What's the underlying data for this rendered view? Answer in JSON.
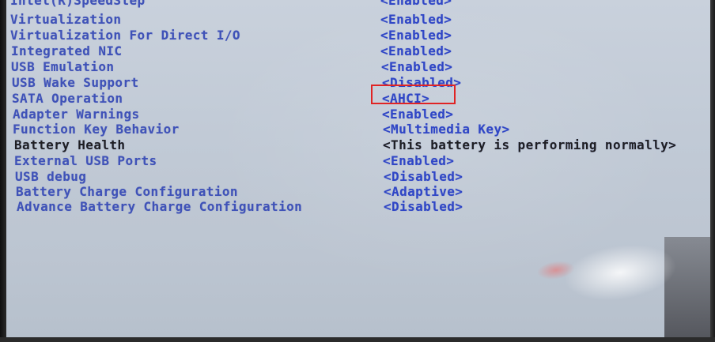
{
  "bios": {
    "settings": [
      {
        "label": "Intel(R)SpeedStep",
        "value": "<Enabled>"
      },
      {
        "label": "Virtualization",
        "value": "<Enabled>"
      },
      {
        "label": "Virtualization For Direct I/O",
        "value": "<Enabled>"
      },
      {
        "label": "Integrated NIC",
        "value": "<Enabled>"
      },
      {
        "label": "USB Emulation",
        "value": "<Enabled>"
      },
      {
        "label": "USB Wake Support",
        "value": "<Disabled>"
      },
      {
        "label": "SATA Operation",
        "value": "<AHCI>"
      },
      {
        "label": "Adapter Warnings",
        "value": "<Enabled>"
      },
      {
        "label": "Function Key Behavior",
        "value": "<Multimedia Key>"
      },
      {
        "label": "Battery Health",
        "value": "<This battery is performing normally>"
      },
      {
        "label": "External USB Ports",
        "value": "<Enabled>"
      },
      {
        "label": "USB debug",
        "value": "<Disabled>"
      },
      {
        "label": "Battery Charge Configuration",
        "value": "<Adaptive>"
      },
      {
        "label": "Advance Battery Charge Configuration",
        "value": "<Disabled>"
      }
    ],
    "highlight_color": "#e02424",
    "text_color": "#3f52b8"
  }
}
